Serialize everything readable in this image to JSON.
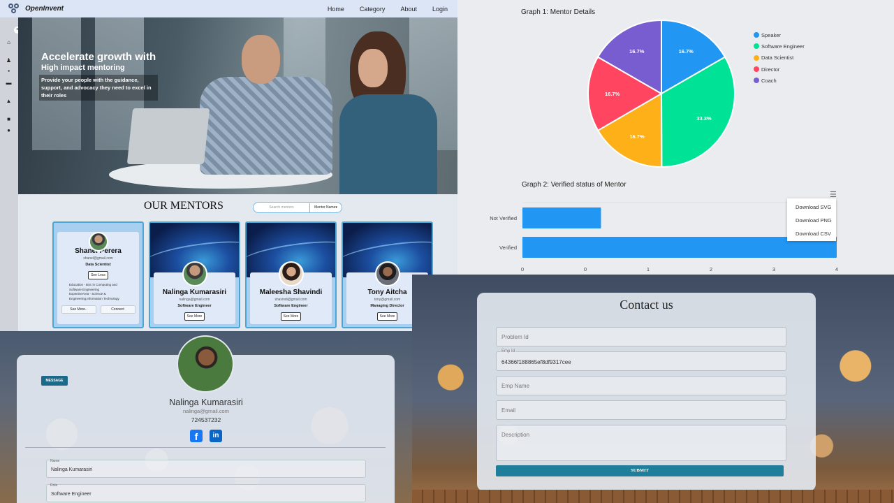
{
  "home": {
    "brand": "OpenInvent",
    "nav": [
      "Home",
      "Category",
      "About",
      "Login"
    ],
    "hero": {
      "title": "Accelerate growth with",
      "subtitle": "High impact mentoring",
      "description": "Provide your people with the guidance, support, and advocacy they need to excel in their roles"
    },
    "mentors_title": "OUR MENTORS",
    "search_placeholder": "Search mentors",
    "filter_value": "Mentor Name",
    "mentors": [
      {
        "name": "Shanel Perera",
        "email": "shanel@gmail.com",
        "role": "Data Scientist",
        "button": "See Less",
        "details": "Education - BSc in Computing and Software Engineering",
        "expertise": "ExpertiseArea - Science & Engineering,Information Technology",
        "see_more": "See More..",
        "connect": "Connect"
      },
      {
        "name": "Nalinga Kumarasiri",
        "email": "nalinga@gmail.com",
        "role": "Software Engineer",
        "button": "See More"
      },
      {
        "name": "Maleesha Shavindi",
        "email": "shavindi@gmail.com",
        "role": "Software Engineer",
        "button": "See More"
      },
      {
        "name": "Tony Aitcha",
        "email": "tony@gmail.com",
        "role": "Managing Director",
        "button": "See More"
      }
    ]
  },
  "graphs": {
    "graph1_title": "Graph 1: Mentor Details",
    "graph2_title": "Graph 2: Verified status of Mentor",
    "download_menu": [
      "Download SVG",
      "Download PNG",
      "Download CSV"
    ]
  },
  "chart_data": [
    {
      "type": "pie",
      "title": "Graph 1: Mentor Details",
      "categories": [
        "Speaker",
        "Software Engineer",
        "Data Scientist",
        "Director",
        "Coach"
      ],
      "values": [
        16.7,
        33.3,
        16.7,
        16.7,
        16.7
      ],
      "labels": [
        "16.7%",
        "33.3%",
        "16.7%",
        "16.7%",
        "16.7%"
      ],
      "colors": [
        "#2196f3",
        "#00e396",
        "#feb019",
        "#ff4560",
        "#775dd0"
      ],
      "legend": "right"
    },
    {
      "type": "bar",
      "orientation": "horizontal",
      "title": "Graph 2: Verified status of Mentor",
      "categories": [
        "Not Verified",
        "Verified"
      ],
      "values": [
        1,
        4
      ],
      "xlim": [
        0,
        4
      ],
      "x_ticks": [
        "0",
        "0",
        "1",
        "2",
        "3",
        "4"
      ],
      "color": "#2196f3"
    }
  ],
  "profile": {
    "message_button": "MESSAGE",
    "name": "Nalinga Kumarasiri",
    "email": "nalinga@gmail.com",
    "phone": "724537232",
    "fields": [
      {
        "label": "Name",
        "value": "Nalinga Kumarasiri"
      },
      {
        "label": "Role",
        "value": "Software Engineer"
      }
    ]
  },
  "contact": {
    "title": "Contact us",
    "problem_id_placeholder": "Problem Id",
    "emp_id_label": "Emp Id",
    "emp_id_value": "64366f188865ef8df9317cee",
    "emp_name_placeholder": "Emp Name",
    "email_placeholder": "Email",
    "description_placeholder": "Description",
    "submit": "SUBMIT"
  }
}
